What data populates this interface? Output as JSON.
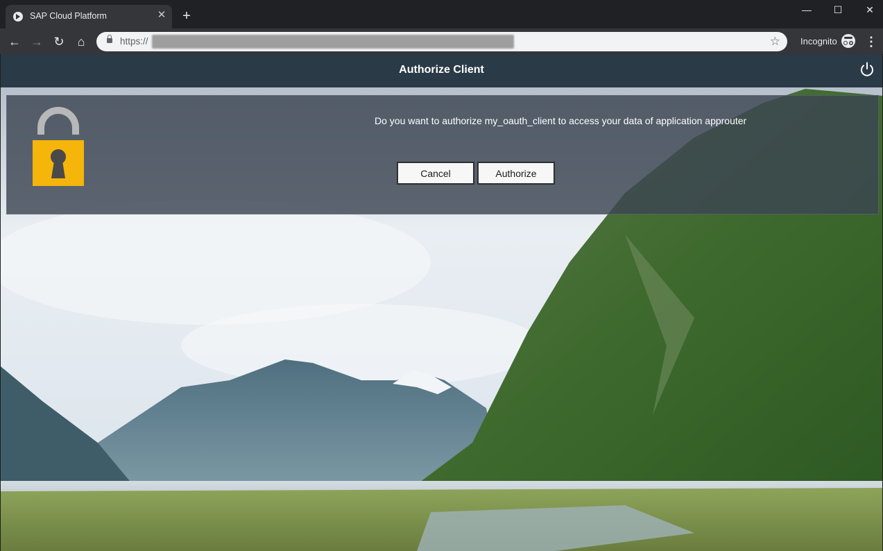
{
  "browser": {
    "tab_title": "SAP Cloud Platform",
    "tab_close": "✕",
    "new_tab": "+",
    "window_controls": {
      "minimize": "—",
      "maximize": "☐",
      "close": "✕"
    },
    "nav": {
      "back": "←",
      "forward": "→",
      "reload": "↻",
      "home": "⌂"
    },
    "url_prefix": "https://",
    "bookmark_icon": "☆",
    "incognito_label": "Incognito",
    "menu_icon": "⋮"
  },
  "app": {
    "title": "Authorize Client",
    "power_icon": "power-icon"
  },
  "dialog": {
    "message": "Do you want to authorize my_oauth_client to access your data of application approuter",
    "cancel_label": "Cancel",
    "authorize_label": "Authorize",
    "lock_color": "#f5b50a",
    "lock_shackle_color": "#b8b8b8"
  }
}
